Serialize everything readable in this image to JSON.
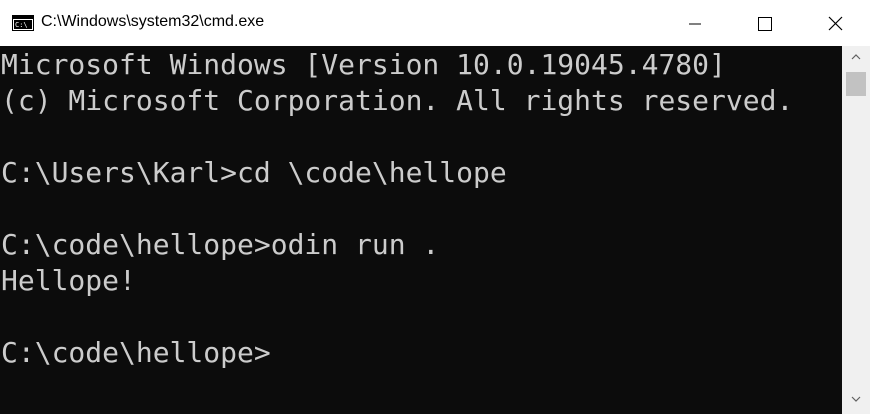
{
  "window": {
    "title": "C:\\Windows\\system32\\cmd.exe",
    "icon": "cmd-app-icon",
    "controls": [
      "minimize-icon",
      "maximize-icon",
      "close-icon"
    ]
  },
  "console": {
    "lines": [
      "Microsoft Windows [Version 10.0.19045.4780]",
      "(c) Microsoft Corporation. All rights reserved.",
      "",
      "C:\\Users\\Karl>cd \\code\\hellope",
      "",
      "C:\\code\\hellope>odin run .",
      "Hellope!",
      "",
      "C:\\code\\hellope>"
    ]
  },
  "colors": {
    "background": "#0c0c0c",
    "text": "#cccccc",
    "titlebar": "#ffffff",
    "scrollbar": "#f0f0f0",
    "scroll_thumb": "#c2c2c2"
  }
}
